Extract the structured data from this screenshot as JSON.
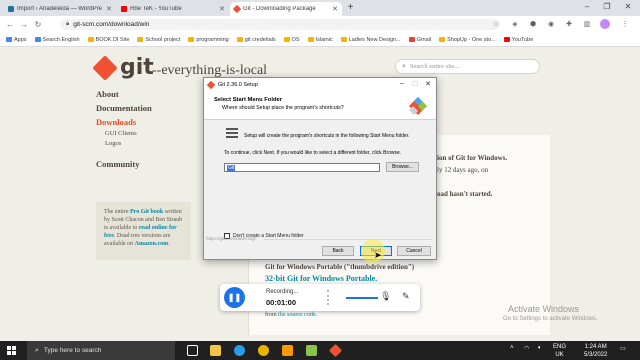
{
  "browser": {
    "tabs": [
      {
        "label": "Import ‹ Anadeleida — WordPre",
        "color": "#21759b"
      },
      {
        "label": "Rbe TeK - YouTube",
        "color": "#ff0000"
      },
      {
        "label": "Git - Downloading Package",
        "color": "#f05133",
        "active": true
      }
    ],
    "new_tab": "+",
    "url": "git-scm.com/download/win",
    "bookmarks": [
      {
        "label": "Apps",
        "color": "#4285f4"
      },
      {
        "label": "Search English",
        "color": "#4285f4"
      },
      {
        "label": "BOOK DI Site",
        "color": "#f4b400"
      },
      {
        "label": "School project",
        "color": "#f4b400"
      },
      {
        "label": "programming",
        "color": "#f4b400"
      },
      {
        "label": "git credetials",
        "color": "#f4b400"
      },
      {
        "label": "OS",
        "color": "#f4b400"
      },
      {
        "label": "Islamic",
        "color": "#f4b400"
      },
      {
        "label": "Ladies New Design...",
        "color": "#f4b400"
      },
      {
        "label": "Gmail",
        "color": "#ea4335"
      },
      {
        "label": "ShopUp - One sto...",
        "color": "#f4b400"
      },
      {
        "label": "YouTube",
        "color": "#ff0000"
      }
    ]
  },
  "site": {
    "logo_text": "git",
    "tagline": "--everything-is-local",
    "search_placeholder": "Search entire site...",
    "nav": {
      "about": "About",
      "documentation": "Documentation",
      "downloads": "Downloads",
      "gui_clients": "GUI Clients",
      "logos": "Logos",
      "community": "Community"
    },
    "book_promo": {
      "t1": "The entire ",
      "link1": "Pro Git book",
      "t2": " written by Scott Chacon and Ben Straub is available to ",
      "link2": "read online for free",
      "t3": ". Dead tree versions are available on ",
      "link3": "Amazon.com",
      "t4": "."
    },
    "content": {
      "frag1": "ion of Git for Windows.",
      "frag2": "ly 12 days ago, on",
      "frag3": "oad hasn't started.",
      "portable": "Git for Windows Portable (\"thumbdrive edition\")",
      "portable_link": "32-bit Git for Windows Portable.",
      "source_prefix": "from ",
      "source_link": "the source code",
      "source_suffix": "."
    }
  },
  "dialog": {
    "title": "Git 2.36.0 Setup",
    "header_title": "Select Start Menu Folder",
    "header_subtitle": "Where should Setup place the program's shortcuts?",
    "line1": "Setup will create the program's shortcuts in the following Start Menu folder.",
    "line2": "To continue, click Next. If you would like to select a different folder, click Browse.",
    "folder_value": "Git",
    "browse_label": "Browse...",
    "checkbox_label": "Don't create a Start Menu folder",
    "watermark": "https://gitforwindows.org/",
    "back_label": "Back",
    "next_label": "Next",
    "cancel_label": "Cancel"
  },
  "recorder": {
    "status": "Recording...",
    "time": "00:01:00"
  },
  "activation": {
    "title": "Activate Windows",
    "subtitle": "Go to Settings to activate Windows."
  },
  "taskbar": {
    "search_placeholder": "Type here to search",
    "language_line1": "ENG",
    "language_line2": "UK",
    "time": "1:24 AM",
    "date": "5/3/2022",
    "app_icons": [
      {
        "name": "task-view-icon",
        "color": "#ffffff"
      },
      {
        "name": "file-explorer-icon",
        "color": "#f4c542"
      },
      {
        "name": "edge-icon",
        "color": "#2b9de6"
      },
      {
        "name": "chrome-icon",
        "color": "#e8b300"
      },
      {
        "name": "sublime-icon",
        "color": "#ff9800"
      },
      {
        "name": "notepadpp-icon",
        "color": "#8bc34a"
      },
      {
        "name": "word-icon",
        "color": "#2b579a"
      },
      {
        "name": "git-setup-icon",
        "color": "#f05133"
      }
    ]
  },
  "colors": {
    "git_orange": "#f05133",
    "git_link": "#0388a6",
    "page_bg": "#f0efe7"
  }
}
